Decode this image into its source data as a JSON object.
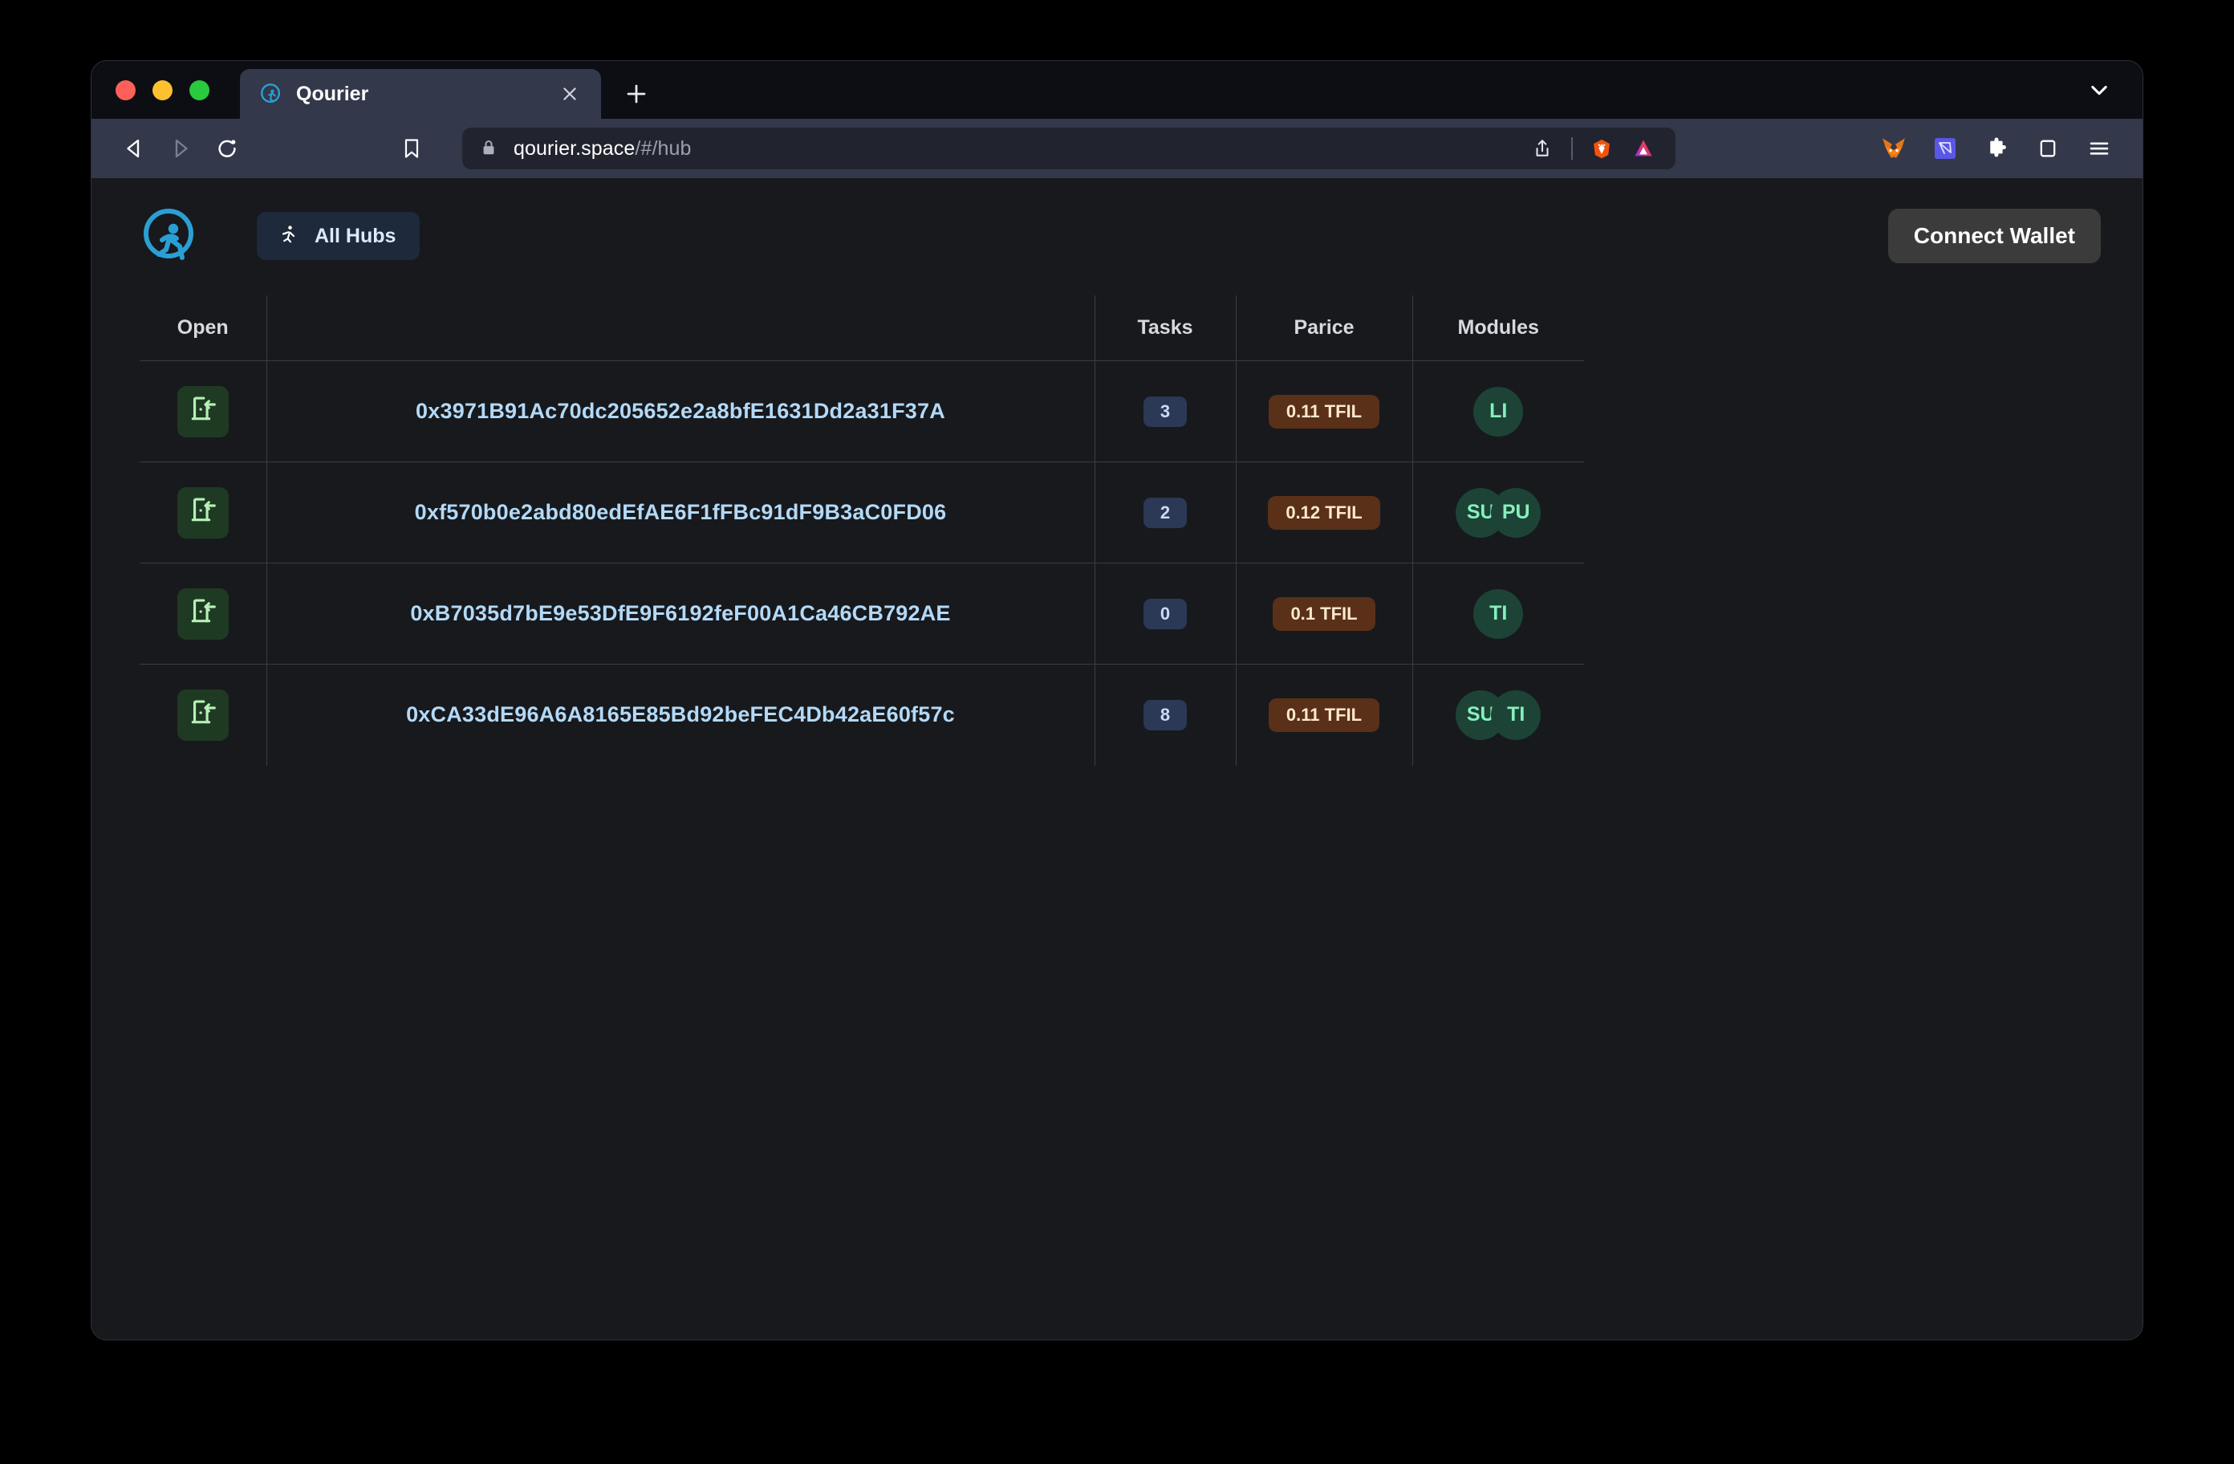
{
  "browser": {
    "tab": {
      "title": "Qourier",
      "favicon_icon": "qourier-logo-icon",
      "close_icon": "close-icon"
    },
    "new_tab_label": "+",
    "tabstrip_chevron_icon": "chevron-down-icon",
    "nav": {
      "back_icon": "back-arrow-icon",
      "forward_icon": "forward-arrow-icon",
      "reload_icon": "reload-icon",
      "bookmark_icon": "bookmark-icon"
    },
    "url": {
      "lock_icon": "lock-icon",
      "domain": "qourier.space",
      "path": "/#/hub",
      "share_icon": "share-icon",
      "brave_shields_icon": "brave-lion-icon",
      "brave_rewards_icon": "brave-rewards-triangle-icon"
    },
    "extensions": [
      {
        "name": "metamask-extension-icon"
      },
      {
        "name": "phantom-or-wallet-extension-icon"
      },
      {
        "name": "extensions-puzzle-icon"
      },
      {
        "name": "sidebar-toggle-icon"
      },
      {
        "name": "browser-menu-icon"
      }
    ]
  },
  "app": {
    "logo_icon": "qourier-runner-logo-icon",
    "all_hubs": {
      "label": "All Hubs",
      "icon": "running-person-icon"
    },
    "connect_wallet_label": "Connect Wallet"
  },
  "table": {
    "headers": {
      "open": "Open",
      "address": "",
      "tasks": "Tasks",
      "price": "Parice",
      "modules": "Modules"
    },
    "rows": [
      {
        "open_icon": "door-enter-icon",
        "address": "0x3971B91Ac70dc205652e2a8bfE1631Dd2a31F37A",
        "tasks": "3",
        "price": "0.11 TFIL",
        "modules": [
          "LI"
        ]
      },
      {
        "open_icon": "door-enter-icon",
        "address": "0xf570b0e2abd80edEfAE6F1fFBc91dF9B3aC0FD06",
        "tasks": "2",
        "price": "0.12 TFIL",
        "modules": [
          "SU",
          "PU"
        ]
      },
      {
        "open_icon": "door-enter-icon",
        "address": "0xB7035d7bE9e53DfE9F6192feF00A1Ca46CB792AE",
        "tasks": "0",
        "price": "0.1 TFIL",
        "modules": [
          "TI"
        ]
      },
      {
        "open_icon": "door-enter-icon",
        "address": "0xCA33dE96A6A8165E85Bd92beFEC4Db42aE60f57c",
        "tasks": "8",
        "price": "0.11 TFIL",
        "modules": [
          "SU",
          "TI"
        ]
      }
    ]
  },
  "colors": {
    "page_bg": "#17191d",
    "tab_bg": "#33384a",
    "address_link": "#b3d9f7",
    "task_badge_bg": "#2b3856",
    "price_badge_bg": "#5a3018",
    "price_badge_text": "#fde8cf",
    "module_avatar_bg": "#1d4336",
    "module_avatar_text": "#85f0bd",
    "open_btn_bg": "#1f3a23",
    "open_btn_icon": "#b6f0b6",
    "all_hubs_bg": "#1e293b",
    "connect_wallet_bg": "#3b3b3b",
    "logo_accent": "#2b9fd4"
  }
}
